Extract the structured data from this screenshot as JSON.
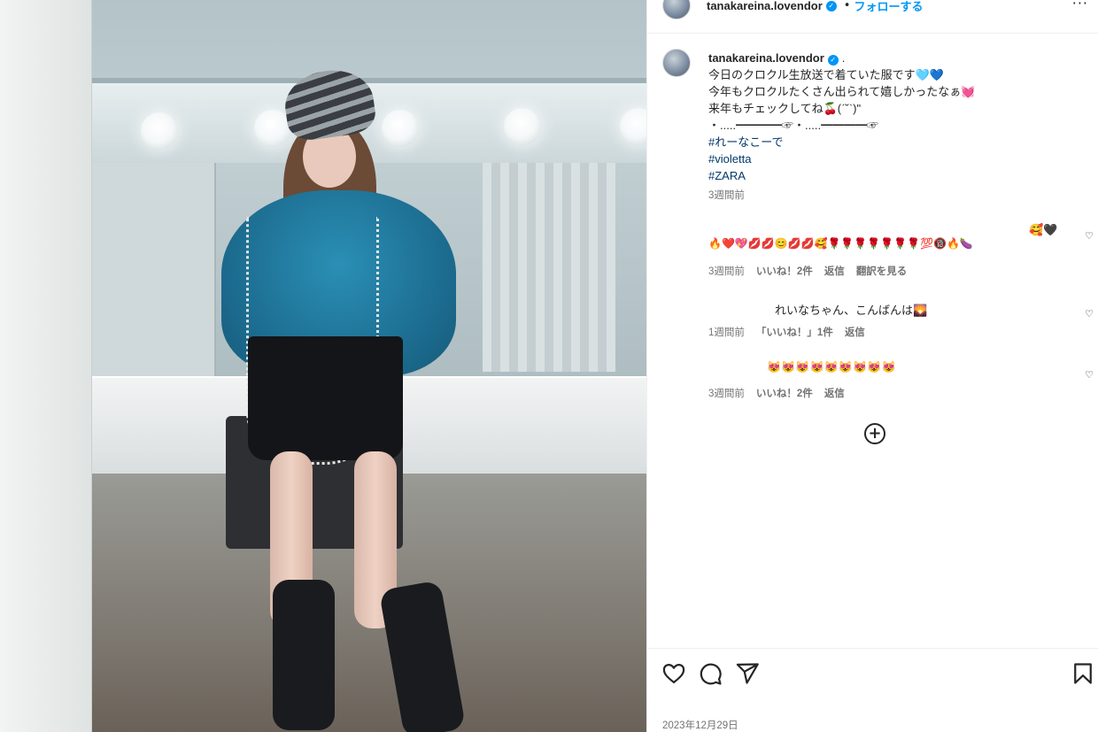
{
  "post": {
    "username": "tanakareina.lovendor",
    "follow_label": "フォローする",
    "separator": "•",
    "more_label": "···"
  },
  "caption": {
    "username": "tanakareina.lovendor",
    "after_name": ".",
    "lines": [
      "今日のクロクル生放送で着ていた服です🩵💙",
      "今年もクロクルたくさん出られて嬉しかったなぁ💓",
      "来年もチェックしてね🍒(ˊ˘ˋ)\"",
      "・.....━━━━☞・.....━━━━☞"
    ],
    "hashtags": [
      "#れーなこーで",
      "#violetta",
      "#ZARA"
    ],
    "time": "3週間前"
  },
  "comments": [
    {
      "text": "🔥❤️💖💋💋😊💋💋🥰🌹🌹🌹🌹🌹🌹🌹💯🔞🔥🍆",
      "extra": "🥰🖤",
      "time": "3週間前",
      "likes": "いいね！2件",
      "reply": "返信",
      "translate": "翻訳を見る"
    },
    {
      "text": "れいなちゃん、こんばんは🌄",
      "time": "1週間前",
      "likes": "「いいね！」1件",
      "reply": "返信"
    },
    {
      "text": "😻😻😻😻😻😻😻😻😻",
      "time": "3週間前",
      "likes": "いいね！2件",
      "reply": "返信"
    }
  ],
  "load_more_label": "+",
  "date": "2023年12月29日",
  "icons": {
    "like": "heart-icon",
    "comment": "comment-icon",
    "share": "share-icon",
    "save": "bookmark-icon",
    "verified": "verified-badge-icon",
    "comment_like": "heart-icon"
  },
  "colors": {
    "follow": "#0095f6",
    "hashtag": "#00376b",
    "meta": "#737373",
    "text": "#262626"
  }
}
